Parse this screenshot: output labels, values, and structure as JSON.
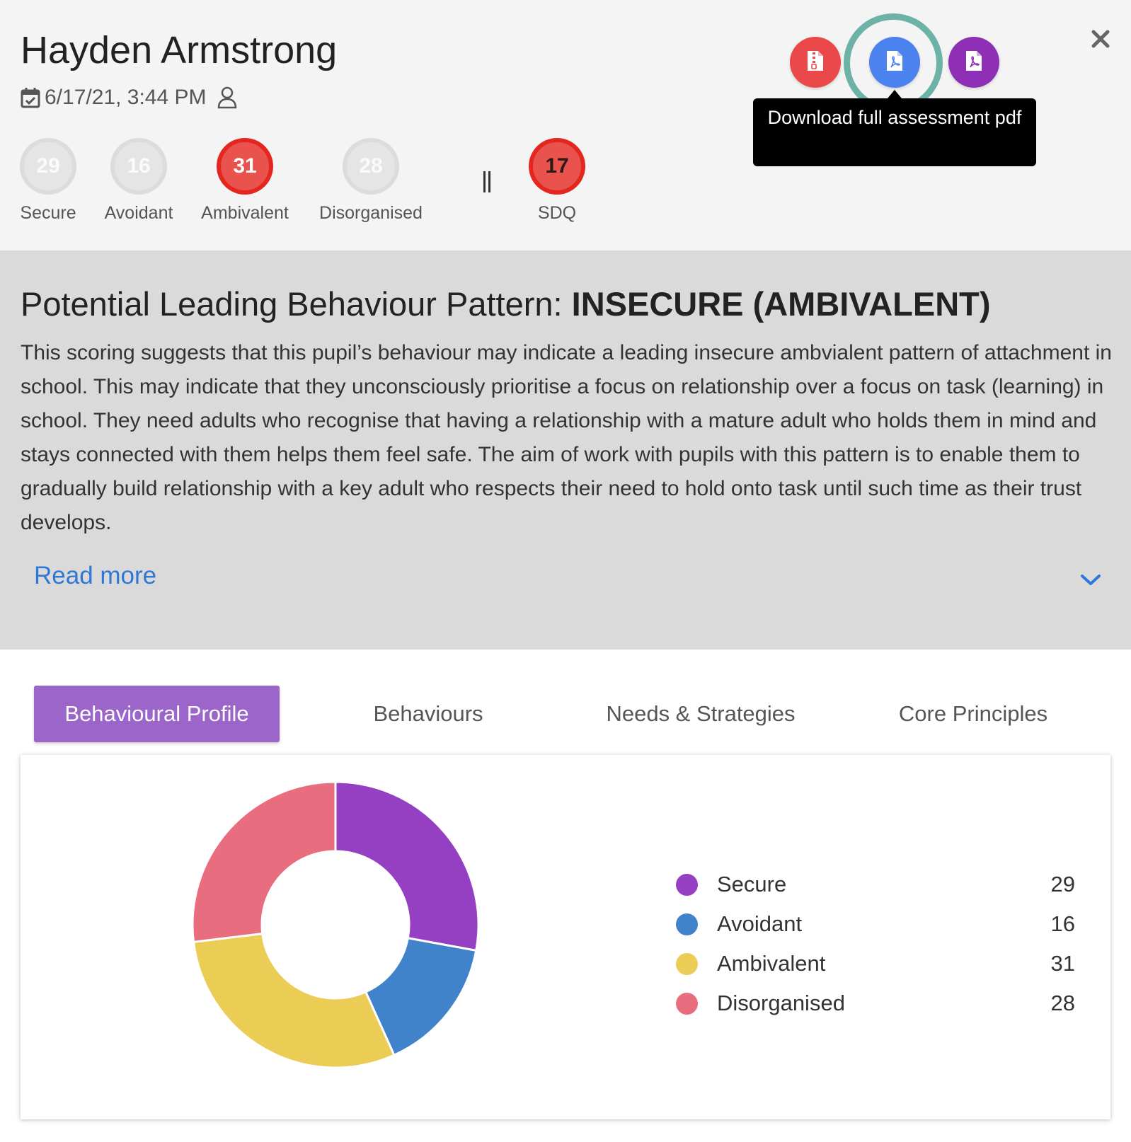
{
  "pupil": {
    "name": "Hayden Armstrong",
    "date": "6/17/21, 3:44 PM",
    "calendar_icon": "calendar-check-icon",
    "user_icon": "user-icon"
  },
  "scores": [
    {
      "value": "29",
      "label": "Secure",
      "style": "muted"
    },
    {
      "value": "16",
      "label": "Avoidant",
      "style": "muted"
    },
    {
      "value": "31",
      "label": "Ambivalent",
      "style": "alert"
    },
    {
      "value": "28",
      "label": "Disorganised",
      "style": "muted"
    },
    {
      "value": "17",
      "label": "SDQ",
      "style": "alert"
    }
  ],
  "actions": {
    "zip_icon": "zip-file-icon",
    "pdf_icon": "pdf-file-icon",
    "tooltip": "Download full assessment pdf",
    "close_icon": "close-icon"
  },
  "pattern": {
    "title_prefix": "Potential Leading Behaviour Pattern: ",
    "title_value": "INSECURE (AMBIVALENT)",
    "description": "This scoring suggests that this pupil’s behaviour may indicate a leading insecure ambvialent pattern of attachment in school. This may indicate that they unconsciously prioritise a focus on relationship over a focus on task (learning) in school. They need adults who recognise that having a relationship with a mature adult who holds them in mind and stays connected with them helps them feel safe. The aim of work with pupils with this pattern is to enable them to gradually build relationship with a key adult who respects their need to hold onto task until such time as their trust develops.",
    "read_more": "Read more"
  },
  "tabs": [
    {
      "label": "Behavioural Profile",
      "active": true
    },
    {
      "label": "Behaviours",
      "active": false
    },
    {
      "label": "Needs & Strategies",
      "active": false
    },
    {
      "label": "Core Principles",
      "active": false
    }
  ],
  "colors": {
    "secure": "#953fc3",
    "avoidant": "#4083cb",
    "ambivalent": "#ebcc55",
    "disorganised": "#e86e7f",
    "accent": "#9b65c9",
    "alert": "#e3271f"
  },
  "chart_data": {
    "type": "pie",
    "variant": "donut",
    "categories": [
      "Secure",
      "Avoidant",
      "Ambivalent",
      "Disorganised"
    ],
    "values": [
      29,
      16,
      31,
      28
    ],
    "colors": [
      "#953fc3",
      "#4083cb",
      "#ebcc55",
      "#e86e7f"
    ],
    "legend": "right"
  }
}
